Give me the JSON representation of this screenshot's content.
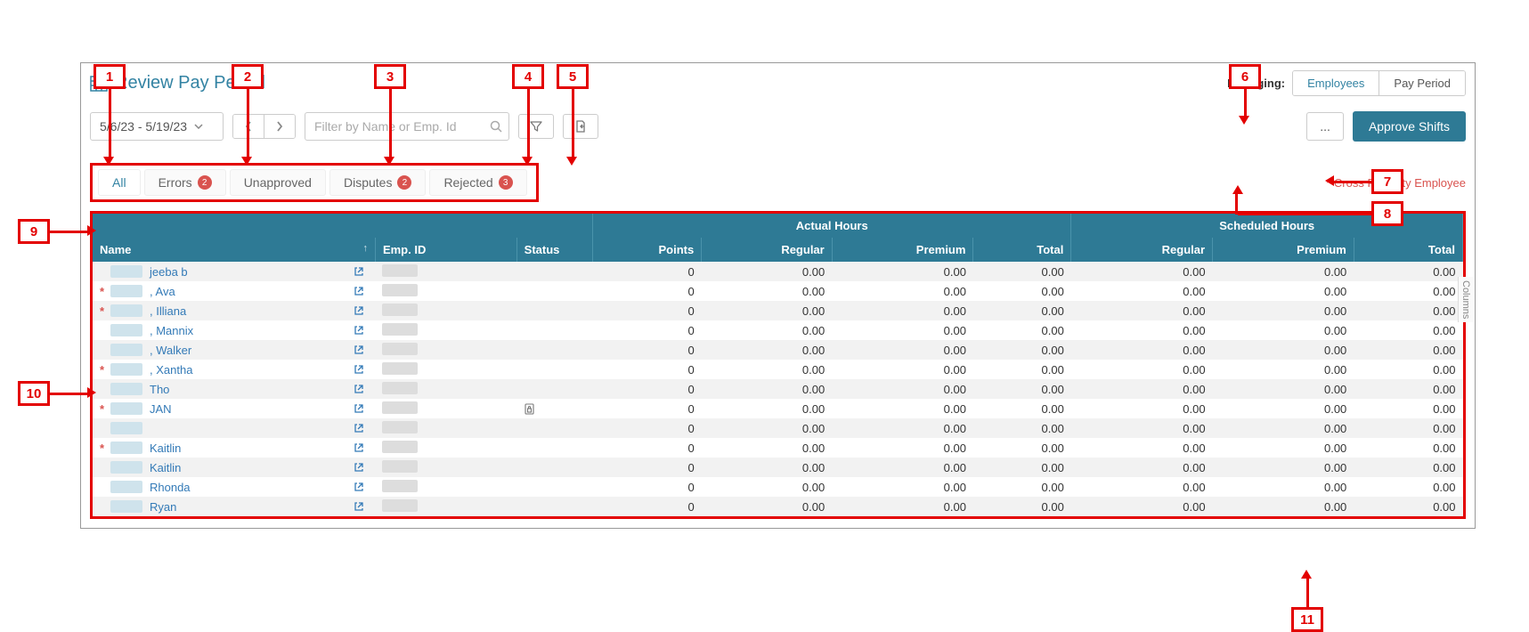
{
  "header": {
    "title": "Review Pay Period",
    "managing_label": "Managing:",
    "seg_employees": "Employees",
    "seg_pay_period": "Pay Period"
  },
  "toolbar": {
    "date_range": "5/6/23 - 5/19/23",
    "search_placeholder": "Filter by Name or Emp. Id",
    "more_label": "...",
    "approve_label": "Approve Shifts"
  },
  "tabs": {
    "all": "All",
    "errors": "Errors",
    "errors_count": "2",
    "unapproved": "Unapproved",
    "disputes": "Disputes",
    "disputes_count": "2",
    "rejected": "Rejected",
    "rejected_count": "3"
  },
  "note": "* Cross Property Employee",
  "columns_side": "Columns",
  "table": {
    "group_actual": "Actual Hours",
    "group_scheduled": "Scheduled Hours",
    "col_name": "Name",
    "col_empid": "Emp. ID",
    "col_status": "Status",
    "col_points": "Points",
    "col_regular": "Regular",
    "col_premium": "Premium",
    "col_total": "Total",
    "rows": [
      {
        "cross": false,
        "name": "jeeba b",
        "status": "",
        "points": "0",
        "a_reg": "0.00",
        "a_prem": "0.00",
        "a_tot": "0.00",
        "s_reg": "0.00",
        "s_prem": "0.00",
        "s_tot": "0.00"
      },
      {
        "cross": true,
        "name": ", Ava",
        "status": "",
        "points": "0",
        "a_reg": "0.00",
        "a_prem": "0.00",
        "a_tot": "0.00",
        "s_reg": "0.00",
        "s_prem": "0.00",
        "s_tot": "0.00"
      },
      {
        "cross": true,
        "name": ", Illiana",
        "status": "",
        "points": "0",
        "a_reg": "0.00",
        "a_prem": "0.00",
        "a_tot": "0.00",
        "s_reg": "0.00",
        "s_prem": "0.00",
        "s_tot": "0.00"
      },
      {
        "cross": false,
        "name": ", Mannix",
        "status": "",
        "points": "0",
        "a_reg": "0.00",
        "a_prem": "0.00",
        "a_tot": "0.00",
        "s_reg": "0.00",
        "s_prem": "0.00",
        "s_tot": "0.00"
      },
      {
        "cross": false,
        "name": ", Walker",
        "status": "",
        "points": "0",
        "a_reg": "0.00",
        "a_prem": "0.00",
        "a_tot": "0.00",
        "s_reg": "0.00",
        "s_prem": "0.00",
        "s_tot": "0.00"
      },
      {
        "cross": true,
        "name": ", Xantha",
        "status": "",
        "points": "0",
        "a_reg": "0.00",
        "a_prem": "0.00",
        "a_tot": "0.00",
        "s_reg": "0.00",
        "s_prem": "0.00",
        "s_tot": "0.00"
      },
      {
        "cross": false,
        "name": "Tho",
        "status": "",
        "points": "0",
        "a_reg": "0.00",
        "a_prem": "0.00",
        "a_tot": "0.00",
        "s_reg": "0.00",
        "s_prem": "0.00",
        "s_tot": "0.00"
      },
      {
        "cross": true,
        "name": "JAN",
        "status": "lock",
        "points": "0",
        "a_reg": "0.00",
        "a_prem": "0.00",
        "a_tot": "0.00",
        "s_reg": "0.00",
        "s_prem": "0.00",
        "s_tot": "0.00"
      },
      {
        "cross": false,
        "name": "",
        "status": "",
        "points": "0",
        "a_reg": "0.00",
        "a_prem": "0.00",
        "a_tot": "0.00",
        "s_reg": "0.00",
        "s_prem": "0.00",
        "s_tot": "0.00"
      },
      {
        "cross": true,
        "name": "Kaitlin",
        "status": "",
        "points": "0",
        "a_reg": "0.00",
        "a_prem": "0.00",
        "a_tot": "0.00",
        "s_reg": "0.00",
        "s_prem": "0.00",
        "s_tot": "0.00"
      },
      {
        "cross": false,
        "name": "Kaitlin",
        "status": "",
        "points": "0",
        "a_reg": "0.00",
        "a_prem": "0.00",
        "a_tot": "0.00",
        "s_reg": "0.00",
        "s_prem": "0.00",
        "s_tot": "0.00"
      },
      {
        "cross": false,
        "name": "Rhonda",
        "status": "",
        "points": "0",
        "a_reg": "0.00",
        "a_prem": "0.00",
        "a_tot": "0.00",
        "s_reg": "0.00",
        "s_prem": "0.00",
        "s_tot": "0.00"
      },
      {
        "cross": false,
        "name": "Ryan",
        "status": "",
        "points": "0",
        "a_reg": "0.00",
        "a_prem": "0.00",
        "a_tot": "0.00",
        "s_reg": "0.00",
        "s_prem": "0.00",
        "s_tot": "0.00"
      }
    ]
  },
  "callouts": {
    "1": "1",
    "2": "2",
    "3": "3",
    "4": "4",
    "5": "5",
    "6": "6",
    "7": "7",
    "8": "8",
    "9": "9",
    "10": "10",
    "11": "11"
  }
}
